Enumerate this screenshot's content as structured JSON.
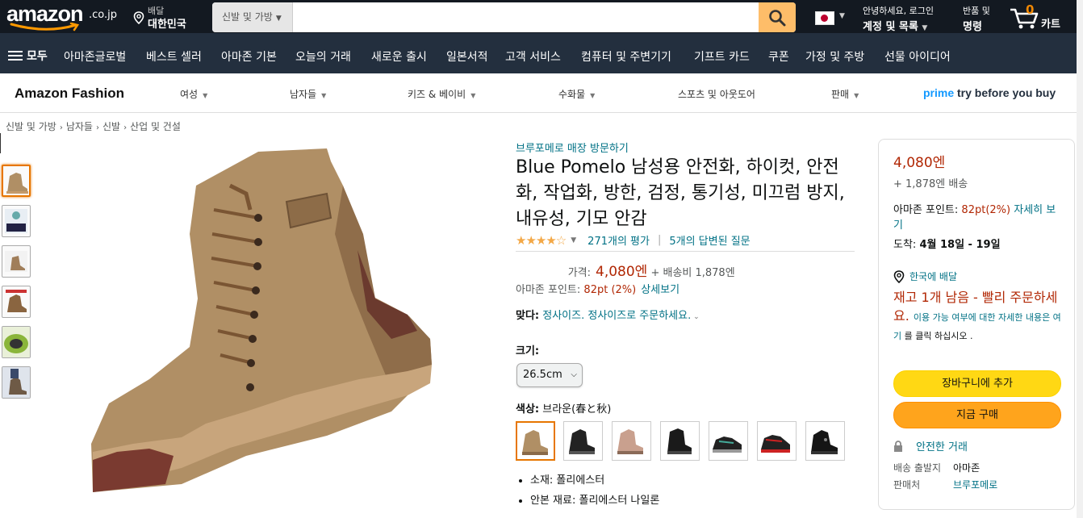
{
  "header": {
    "logo": "amazon",
    "logo_tld": ".co.jp",
    "deliver_line1": "배달",
    "deliver_line2": "대한민국",
    "search_category": "신발 및 가방",
    "search_value": "",
    "account_line1": "안녕하세요, 로그인",
    "account_line2": "계정 및 목록",
    "returns_line1": "반품 및",
    "returns_line2": "명령",
    "cart_count": "0",
    "cart_label": "카트"
  },
  "nav": {
    "all": "모두",
    "items": [
      "아마존글로벌",
      "베스트 셀러",
      "아마존 기본",
      "오늘의 거래",
      "새로운 출시",
      "일본서적",
      "고객 서비스",
      "컴퓨터 및 주변기기",
      "기프트 카드",
      "쿠폰",
      "가정 및 주방",
      "선물 아이디어"
    ]
  },
  "fashion": {
    "brand": "Amazon Fashion",
    "items": [
      "여성",
      "남자들",
      "키즈 & 베이비",
      "수화물",
      "스포츠 및 아웃도어",
      "판매"
    ],
    "prime": "prime",
    "prime_tail": "try before you buy"
  },
  "breadcrumb": [
    "신발 및 가방",
    "남자들",
    "신발",
    "산업 및 건설"
  ],
  "product": {
    "store_link": "브루포메로 매장 방문하기",
    "title": "Blue Pomelo 남성용 안전화, 하이컷, 안전화, 작업화, 방한, 검정, 통기성, 미끄럼 방지, 내유성, 기모 안감",
    "stars": "★★★★☆",
    "rating_value": 4,
    "ratings_link": "271개의 평가",
    "qa_link": "5개의 답변된 질문",
    "price_label": "가격:",
    "price": "4,080엔",
    "shipping": "+ 배송비 1,878엔",
    "points_label": "아마존 포인트:",
    "points": "82pt (2%)",
    "points_link": "상세보기",
    "fit_label": "맞다:",
    "fit_link": "정사이즈. 정사이즈로 주문하세요.",
    "size_label": "크기:",
    "size_value": "26.5cm",
    "color_label": "색상:",
    "color_value": "브라운(春と秋)",
    "bullets": [
      "소재: 폴리에스터",
      "안본 재료: 폴리에스터 나일론"
    ]
  },
  "buybox": {
    "price": "4,080엔",
    "shipping": "+ 1,878엔 배송",
    "points_label": "아마존 포인트:",
    "points": "82pt(2%)",
    "points_link": "자세히 보기",
    "delivery_label": "도착:",
    "delivery_date": "4월 18일 - 19일",
    "deliver_to": "한국에 배달",
    "stock": "재고 1개 남음 - 빨리 주문하세요.",
    "stock_more_a": "이용 가능 여부에 대한 자세한 내용은 여기",
    "stock_more_b": "를 클릭 하십시오 .",
    "add_to_cart": "장바구니에 추가",
    "buy_now": "지금 구매",
    "secure": "안전한 거래",
    "ship_from_label": "배송 출발지",
    "ship_from": "아마존",
    "seller_label": "판매처",
    "seller": "브루포메로"
  },
  "colors": {
    "header_bg": "#131921",
    "nav_bg": "#232f3e",
    "accent": "#febd69",
    "price": "#b12704",
    "link": "#007185",
    "cart_button": "#ffd814",
    "buy_button": "#ffa41c"
  }
}
